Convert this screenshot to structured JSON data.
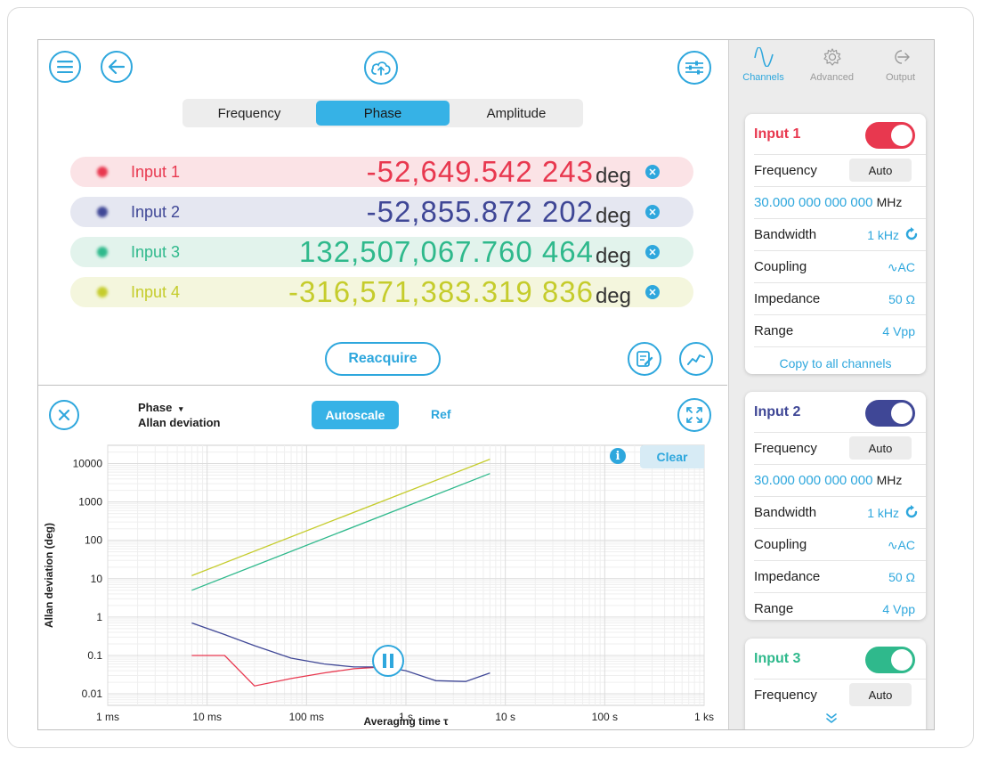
{
  "segments": {
    "items": [
      "Frequency",
      "Phase",
      "Amplitude"
    ],
    "active": "Phase"
  },
  "channels": [
    {
      "name": "Input 1",
      "value": "-52,649.542 243",
      "unit": "deg",
      "color": "#e8384f",
      "bg": "#fbe3e6"
    },
    {
      "name": "Input 2",
      "value": "-52,855.872 202",
      "unit": "deg",
      "color": "#3f4796",
      "bg": "#e5e7f1"
    },
    {
      "name": "Input 3",
      "value": "132,507,067.760 464",
      "unit": "deg",
      "color": "#2fb98c",
      "bg": "#e2f3ec"
    },
    {
      "name": "Input 4",
      "value": "-316,571,383.319 836",
      "unit": "deg",
      "color": "#c5cc2c",
      "bg": "#f4f6dd"
    }
  ],
  "reacquire_label": "Reacquire",
  "plot_header": {
    "mode": "Phase",
    "mode_caret": "▾",
    "measurement": "Allan deviation",
    "autoscale_label": "Autoscale",
    "ref_label": "Ref",
    "clear_label": "Clear",
    "info_glyph": "i"
  },
  "chart_data": {
    "type": "line",
    "xlabel": "Averaging time τ",
    "ylabel": "Allan deviation (deg)",
    "xscale": "log",
    "yscale": "log",
    "xlim": [
      0.001,
      1000
    ],
    "ylim": [
      0.005,
      30000
    ],
    "xticks": [
      0.001,
      0.01,
      0.1,
      1,
      10,
      100,
      1000
    ],
    "xtick_labels": [
      "1 ms",
      "10 ms",
      "100 ms",
      "1 s",
      "10 s",
      "100 s",
      "1 ks"
    ],
    "yticks": [
      0.01,
      0.1,
      1,
      10,
      100,
      1000,
      10000
    ],
    "ytick_labels": [
      "0.01",
      "0.1",
      "1",
      "10",
      "100",
      "1000",
      "10000"
    ],
    "grid": true,
    "series": [
      {
        "color": "#e8384f",
        "x": [
          0.007,
          0.015,
          0.03,
          0.07,
          0.15,
          0.3,
          0.6
        ],
        "y": [
          0.1,
          0.1,
          0.016,
          0.025,
          0.035,
          0.045,
          0.05
        ]
      },
      {
        "color": "#3f4796",
        "x": [
          0.007,
          0.015,
          0.03,
          0.07,
          0.15,
          0.3,
          0.6,
          1,
          2,
          4,
          7
        ],
        "y": [
          0.7,
          0.35,
          0.18,
          0.085,
          0.06,
          0.05,
          0.05,
          0.04,
          0.022,
          0.021,
          0.035
        ]
      },
      {
        "color": "#2fb98c",
        "x": [
          0.007,
          7
        ],
        "y": [
          5,
          5500
        ]
      },
      {
        "color": "#c5cc2c",
        "x": [
          0.007,
          7
        ],
        "y": [
          12,
          13000
        ]
      }
    ]
  },
  "sidebar": {
    "tabs": [
      {
        "label": "Channels",
        "icon": "sine-wave-icon",
        "active": true
      },
      {
        "label": "Advanced",
        "icon": "gear-icon",
        "active": false
      },
      {
        "label": "Output",
        "icon": "output-arrow-icon",
        "active": false
      }
    ],
    "cards": [
      {
        "title": "Input 1",
        "color": "#e8384f",
        "enabled": true,
        "frequency_label": "Frequency",
        "frequency_mode": "Auto",
        "frequency_value": "30.000 000 000 000",
        "frequency_unit": "MHz",
        "rows": [
          {
            "label": "Bandwidth",
            "value": "1 kHz"
          },
          {
            "label": "Coupling",
            "value": "AC"
          },
          {
            "label": "Impedance",
            "value": "50 Ω"
          },
          {
            "label": "Range",
            "value": "4 Vpp"
          }
        ],
        "copy_label": "Copy to all channels"
      },
      {
        "title": "Input 2",
        "color": "#3f4796",
        "enabled": true,
        "frequency_label": "Frequency",
        "frequency_mode": "Auto",
        "frequency_value": "30.000 000 000 000",
        "frequency_unit": "MHz",
        "rows": [
          {
            "label": "Bandwidth",
            "value": "1 kHz"
          },
          {
            "label": "Coupling",
            "value": "AC"
          },
          {
            "label": "Impedance",
            "value": "50 Ω"
          },
          {
            "label": "Range",
            "value": "4 Vpp"
          }
        ]
      },
      {
        "title": "Input 3",
        "color": "#2fb98c",
        "enabled": true,
        "frequency_label": "Frequency",
        "frequency_mode": "Auto"
      }
    ]
  }
}
